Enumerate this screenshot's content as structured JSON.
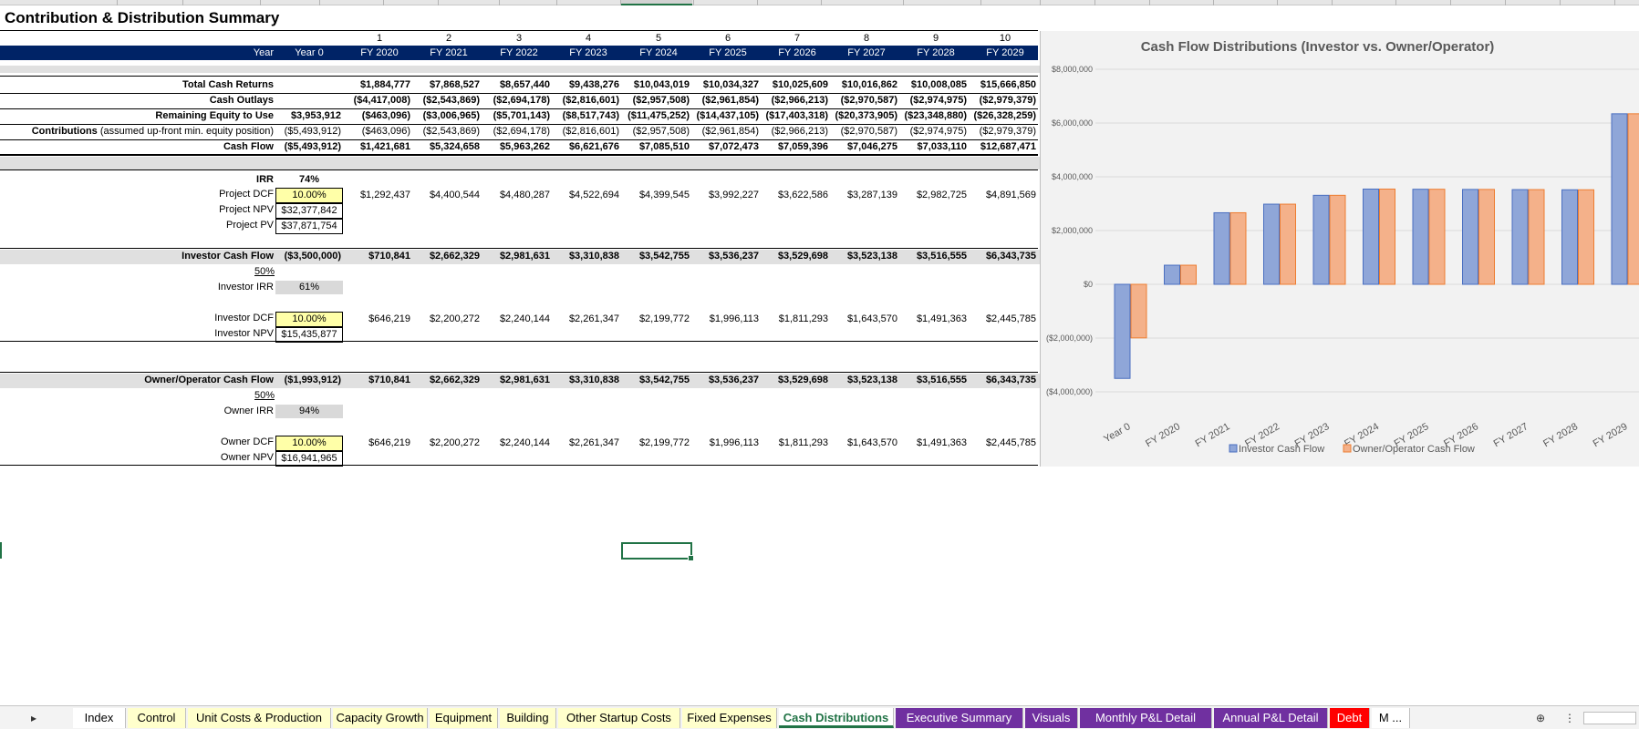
{
  "title": "Contribution & Distribution Summary",
  "header": {
    "periods": [
      "1",
      "2",
      "3",
      "4",
      "5",
      "6",
      "7",
      "8",
      "9",
      "10"
    ],
    "year_label": "Year",
    "year0": "Year 0",
    "fy": [
      "FY 2020",
      "FY 2021",
      "FY 2022",
      "FY 2023",
      "FY 2024",
      "FY 2025",
      "FY 2026",
      "FY 2027",
      "FY 2028",
      "FY 2029"
    ]
  },
  "summary": {
    "total_cash_returns": {
      "label": "Total Cash Returns",
      "y0": "",
      "values": [
        "$1,884,777",
        "$7,868,527",
        "$8,657,440",
        "$9,438,276",
        "$10,043,019",
        "$10,034,327",
        "$10,025,609",
        "$10,016,862",
        "$10,008,085",
        "$15,666,850"
      ]
    },
    "cash_outlays": {
      "label": "Cash Outlays",
      "y0": "",
      "values": [
        "($4,417,008)",
        "($2,543,869)",
        "($2,694,178)",
        "($2,816,601)",
        "($2,957,508)",
        "($2,961,854)",
        "($2,966,213)",
        "($2,970,587)",
        "($2,974,975)",
        "($2,979,379)"
      ]
    },
    "remaining_equity": {
      "label": "Remaining Equity to Use",
      "y0": "$3,953,912",
      "values": [
        "($463,096)",
        "($3,006,965)",
        "($5,701,143)",
        "($8,517,743)",
        "($11,475,252)",
        "($14,437,105)",
        "($17,403,318)",
        "($20,373,905)",
        "($23,348,880)",
        "($26,328,259)"
      ]
    },
    "contributions": {
      "label_bold": "Contributions",
      "label_rest": " (assumed up-front min. equity position)",
      "y0": "($5,493,912)",
      "values": [
        "($463,096)",
        "($2,543,869)",
        "($2,694,178)",
        "($2,816,601)",
        "($2,957,508)",
        "($2,961,854)",
        "($2,966,213)",
        "($2,970,587)",
        "($2,974,975)",
        "($2,979,379)"
      ]
    },
    "cash_flow": {
      "label": "Cash Flow",
      "y0": "($5,493,912)",
      "values": [
        "$1,421,681",
        "$5,324,658",
        "$5,963,262",
        "$6,621,676",
        "$7,085,510",
        "$7,072,473",
        "$7,059,396",
        "$7,046,275",
        "$7,033,110",
        "$12,687,471"
      ]
    }
  },
  "project": {
    "irr_label": "IRR",
    "irr": "74%",
    "dcf_label": "Project DCF",
    "dcf": "10.00%",
    "dcf_values": [
      "$1,292,437",
      "$4,400,544",
      "$4,480,287",
      "$4,522,694",
      "$4,399,545",
      "$3,992,227",
      "$3,622,586",
      "$3,287,139",
      "$2,982,725",
      "$4,891,569"
    ],
    "npv_label": "Project NPV",
    "npv": "$32,377,842",
    "pv_label": "Project PV",
    "pv": "$37,871,754"
  },
  "investor": {
    "cf_label": "Investor Cash Flow",
    "cf_y0": "($3,500,000)",
    "cf_values": [
      "$710,841",
      "$2,662,329",
      "$2,981,631",
      "$3,310,838",
      "$3,542,755",
      "$3,536,237",
      "$3,529,698",
      "$3,523,138",
      "$3,516,555",
      "$6,343,735"
    ],
    "share": "50%",
    "irr_label": "Investor IRR",
    "irr": "61%",
    "dcf_label": "Investor DCF",
    "dcf": "10.00%",
    "dcf_values": [
      "$646,219",
      "$2,200,272",
      "$2,240,144",
      "$2,261,347",
      "$2,199,772",
      "$1,996,113",
      "$1,811,293",
      "$1,643,570",
      "$1,491,363",
      "$2,445,785"
    ],
    "npv_label": "Investor NPV",
    "npv": "$15,435,877"
  },
  "owner": {
    "cf_label": "Owner/Operator Cash Flow",
    "cf_y0": "($1,993,912)",
    "cf_values": [
      "$710,841",
      "$2,662,329",
      "$2,981,631",
      "$3,310,838",
      "$3,542,755",
      "$3,536,237",
      "$3,529,698",
      "$3,523,138",
      "$3,516,555",
      "$6,343,735"
    ],
    "share": "50%",
    "irr_label": "Owner IRR",
    "irr": "94%",
    "dcf_label": "Owner DCF",
    "dcf": "10.00%",
    "dcf_values": [
      "$646,219",
      "$2,200,272",
      "$2,240,144",
      "$2,261,347",
      "$2,199,772",
      "$1,996,113",
      "$1,811,293",
      "$1,643,570",
      "$1,491,363",
      "$2,445,785"
    ],
    "npv_label": "Owner NPV",
    "npv": "$16,941,965"
  },
  "chart_data": {
    "type": "bar",
    "title": "Cash Flow Distributions (Investor vs. Owner/Operator)",
    "categories": [
      "Year 0",
      "FY 2020",
      "FY 2021",
      "FY 2022",
      "FY 2023",
      "FY 2024",
      "FY 2025",
      "FY 2026",
      "FY 2027",
      "FY 2028",
      "FY 2029"
    ],
    "series": [
      {
        "name": "Investor Cash Flow",
        "color": "#8fa6d8",
        "edge": "#4a6fc0",
        "values": [
          -3500000,
          710841,
          2662329,
          2981631,
          3310838,
          3542755,
          3536237,
          3529698,
          3523138,
          3516555,
          6343735
        ]
      },
      {
        "name": "Owner/Operator Cash Flow",
        "color": "#f4b18a",
        "edge": "#ed7d31",
        "values": [
          -1993912,
          710841,
          2662329,
          2981631,
          3310838,
          3542755,
          3536237,
          3529698,
          3523138,
          3516555,
          6343735
        ]
      }
    ],
    "ylim": [
      -4000000,
      8000000
    ],
    "yticks": [
      8000000,
      6000000,
      4000000,
      2000000,
      0,
      -2000000,
      -4000000
    ],
    "ytick_labels": [
      "$8,000,000",
      "$6,000,000",
      "$4,000,000",
      "$2,000,000",
      "$0",
      "($2,000,000)",
      "($4,000,000)"
    ],
    "legend_position": "bottom"
  },
  "tabs": [
    {
      "label": "Index",
      "style": "white-tab"
    },
    {
      "label": "Control",
      "style": "yellow-tab"
    },
    {
      "label": "Unit Costs & Production",
      "style": "yellow-tab"
    },
    {
      "label": "Capacity Growth",
      "style": "yellow-tab"
    },
    {
      "label": "Equipment",
      "style": "yellow-tab"
    },
    {
      "label": "Building",
      "style": "yellow-tab"
    },
    {
      "label": "Other Startup Costs",
      "style": "yellow-tab"
    },
    {
      "label": "Fixed Expenses",
      "style": "yellow-tab"
    },
    {
      "label": "Cash Distributions",
      "style": "active"
    },
    {
      "label": "Executive Summary",
      "style": "purple"
    },
    {
      "label": "Visuals",
      "style": "purple"
    },
    {
      "label": "Monthly P&L Detail",
      "style": "purple"
    },
    {
      "label": "Annual P&L Detail",
      "style": "purple"
    },
    {
      "label": "Debt",
      "style": "red"
    },
    {
      "label": "M ...",
      "style": "white-tab"
    }
  ],
  "nav": {
    "next": "▸",
    "add": "⊕",
    "more": "⋮"
  }
}
